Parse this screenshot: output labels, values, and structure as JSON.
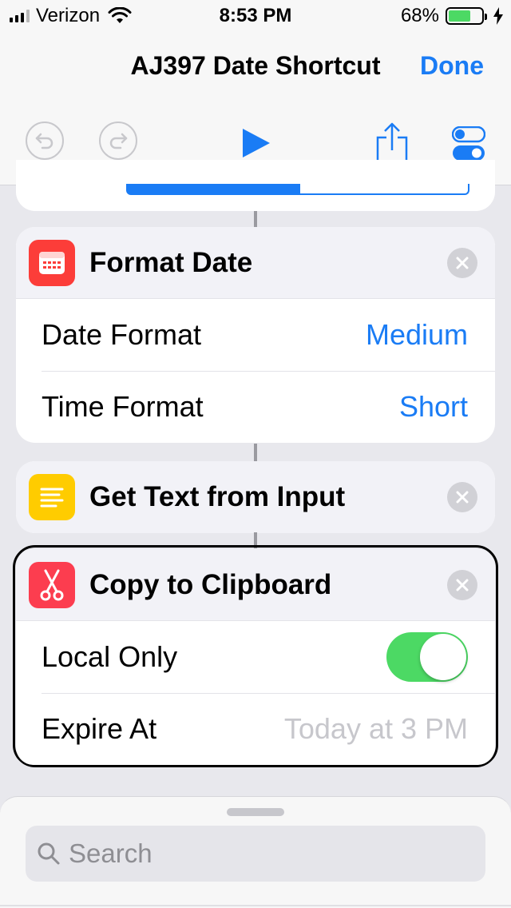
{
  "status_bar": {
    "carrier": "Verizon",
    "time": "8:53 PM",
    "battery": "68%",
    "battery_level": 0.68
  },
  "nav": {
    "title": "AJ397 Date Shortcut",
    "done_label": "Done"
  },
  "toolbar": {
    "icons": [
      "undo-icon",
      "redo-icon",
      "play-icon",
      "share-icon",
      "settings-toggle-icon"
    ]
  },
  "actions": [
    {
      "title": "Format Date",
      "icon": "calendar-icon",
      "icon_color": "#fc3d39",
      "rows": [
        {
          "label": "Date Format",
          "value": "Medium"
        },
        {
          "label": "Time Format",
          "value": "Short"
        }
      ]
    },
    {
      "title": "Get Text from Input",
      "icon": "text-lines-icon",
      "icon_color": "#ffcc00"
    },
    {
      "title": "Copy to Clipboard",
      "icon": "scissors-icon",
      "icon_color": "#fc3d4f",
      "rows": [
        {
          "label": "Local Only",
          "toggle_on": true
        },
        {
          "label": "Expire At",
          "value": "Today at 3 PM"
        }
      ]
    }
  ],
  "search": {
    "placeholder": "Search"
  },
  "colors": {
    "accent": "#1a7cf5",
    "toggle_on": "#4cd964"
  }
}
